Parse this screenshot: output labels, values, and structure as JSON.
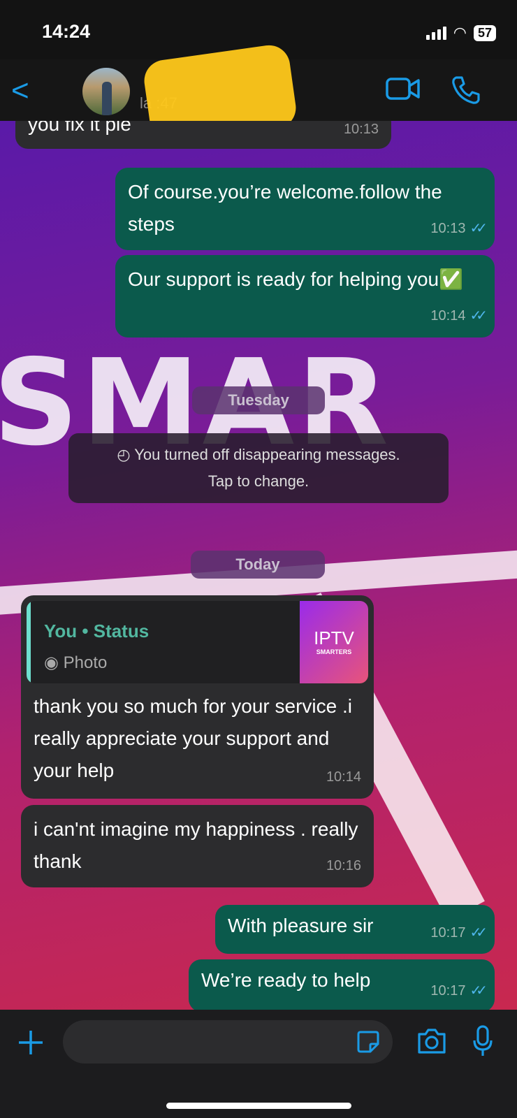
{
  "status_bar": {
    "time": "14:24",
    "battery": "57"
  },
  "header": {
    "back_label": "<",
    "last_seen": "la            :47"
  },
  "messages": [
    {
      "dir": "in",
      "text": "you fix it ple",
      "time": "10:13"
    },
    {
      "dir": "out",
      "text": "Of course.you’re welcome.follow the steps",
      "time": "10:13"
    },
    {
      "dir": "out",
      "text": "Our support is ready for  helping you✅",
      "time": "10:14"
    },
    {
      "dir": "in",
      "quote": {
        "title": "You • Status",
        "subtitle": "Photo",
        "thumb_text": "IPTV",
        "thumb_sub": "SMARTERS"
      },
      "text": "thank you so much for your service .i really appreciate your support and your help",
      "time": "10:14"
    },
    {
      "dir": "in",
      "text": "i can'nt imagine my happiness . really thank",
      "time": "10:16"
    },
    {
      "dir": "out",
      "text": "With pleasure sir",
      "time": "10:17"
    },
    {
      "dir": "out",
      "text": "We’re ready to help",
      "time": "10:17"
    }
  ],
  "separators": {
    "tuesday": "Tuesday",
    "today": "Today"
  },
  "system": {
    "line1": "You turned off disappearing messages.",
    "line2": "Tap to change."
  },
  "wallpaper": {
    "text1": "SMAR"
  },
  "colors": {
    "accent": "#1a9be6",
    "outgoing": "#0b5a4c",
    "incoming": "#2c2c2e"
  }
}
